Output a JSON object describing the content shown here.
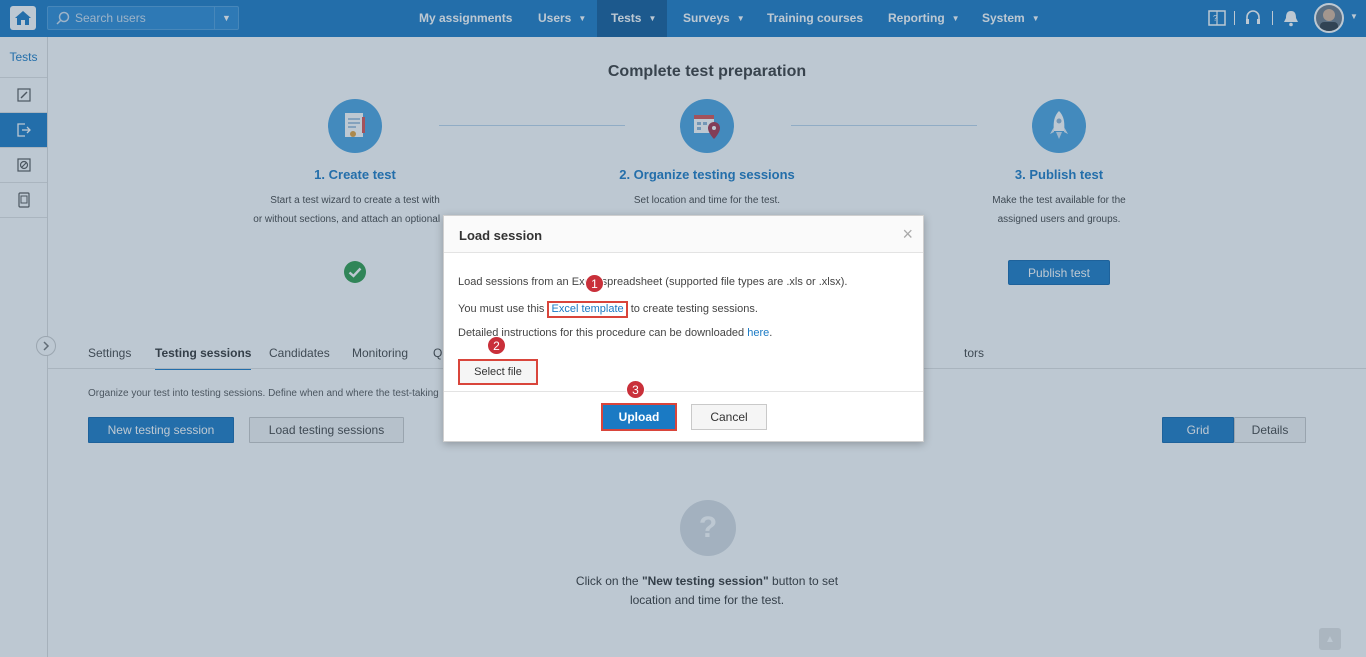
{
  "topbar": {
    "search": {
      "placeholder": "Search users"
    },
    "nav": [
      {
        "label": "My assignments",
        "dropdown": false
      },
      {
        "label": "Users",
        "dropdown": true
      },
      {
        "label": "Tests",
        "dropdown": true,
        "active": true
      },
      {
        "label": "Surveys",
        "dropdown": true
      },
      {
        "label": "Training courses",
        "dropdown": false
      },
      {
        "label": "Reporting",
        "dropdown": true
      },
      {
        "label": "System",
        "dropdown": true
      }
    ],
    "icons": [
      "book-icon",
      "headset-icon",
      "bell-icon",
      "avatar"
    ]
  },
  "sidebar": {
    "title": "Tests",
    "items": [
      "edit-icon",
      "export-icon",
      "ban-icon",
      "tablet-icon"
    ]
  },
  "main": {
    "title": "Complete test preparation",
    "steps": [
      {
        "title": "1. Create test",
        "desc_line1": "Start a test wizard to create a test with",
        "desc_line2": "or without sections, and attach an optional cer"
      },
      {
        "title": "2. Organize testing sessions",
        "desc_line1": "Set location and time for the test.",
        "desc_line2": ""
      },
      {
        "title": "3. Publish test",
        "desc_line1": "Make the test available for the",
        "desc_line2": "assigned users and groups."
      }
    ],
    "publish_label": "Publish test",
    "tabs": [
      "Settings",
      "Testing sessions",
      "Candidates",
      "Monitoring",
      "Q",
      "tors"
    ],
    "active_tab": "Testing sessions",
    "hint": "Organize your test into testing sessions. Define when and where the test-taking",
    "new_session_label": "New testing session",
    "load_sessions_label": "Load testing sessions",
    "view_toggle": {
      "grid": "Grid",
      "details": "Details"
    },
    "empty": {
      "line1_prefix": "Click on the ",
      "line1_bold": "\"New testing session\"",
      "line1_suffix": " button to set",
      "line2": "location and time for the test."
    }
  },
  "modal": {
    "title": "Load session",
    "line1": "Load sessions from an Excel spreadsheet (supported file types are .xls or .xlsx).",
    "line2_prefix": "You must use this ",
    "line2_link": "Excel template",
    "line2_suffix": " to create testing sessions.",
    "line3_prefix": "Detailed instructions for this procedure can be downloaded ",
    "line3_link": "here",
    "line3_suffix": ".",
    "select_file_label": "Select file",
    "upload_label": "Upload",
    "cancel_label": "Cancel",
    "close_glyph": "×"
  },
  "markers": [
    "1",
    "2",
    "3"
  ],
  "colors": {
    "primary": "#1a7ac4",
    "highlight": "#d9453b",
    "marker": "#c9303a"
  }
}
